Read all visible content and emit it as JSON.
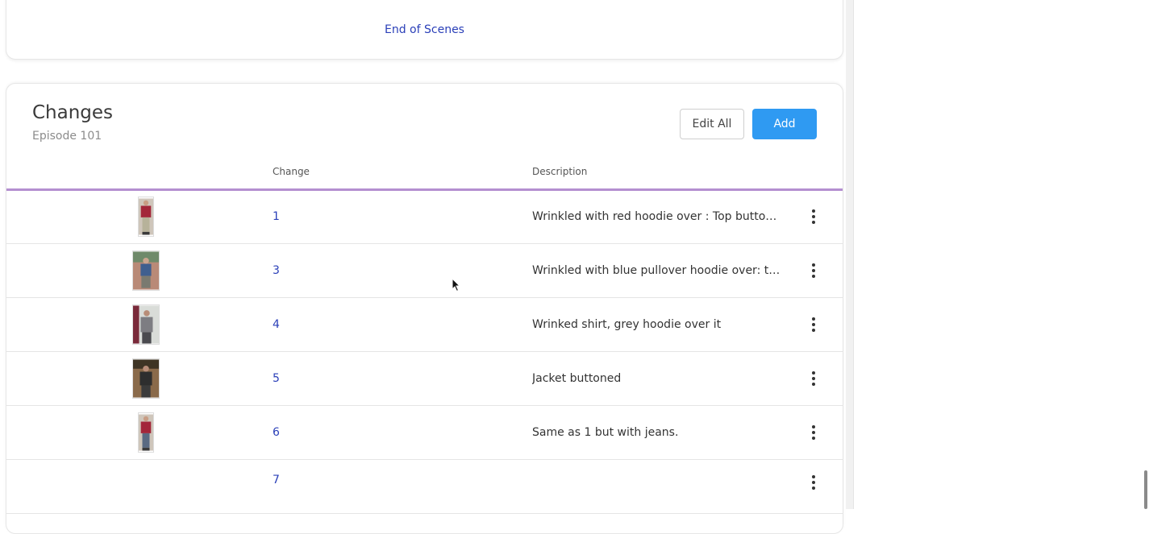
{
  "scenes": {
    "end_label": "End of Scenes"
  },
  "changes": {
    "title": "Changes",
    "subtitle": "Episode 101",
    "edit_all_label": "Edit All",
    "add_label": "Add",
    "columns": {
      "change": "Change",
      "description": "Description"
    },
    "rows": [
      {
        "change": "1",
        "description": "Wrinkled with red hoodie over : Top button u...",
        "thumbnail": "red-hoodie-outfit"
      },
      {
        "change": "3",
        "description": "Wrinkled with blue pullover hoodie over: top...",
        "thumbnail": "blue-hoodie-outfit"
      },
      {
        "change": "4",
        "description": "Wrinked shirt, grey hoodie over it",
        "thumbnail": "grey-hoodie-outfit"
      },
      {
        "change": "5",
        "description": "Jacket buttoned",
        "thumbnail": "jacket-outfit"
      },
      {
        "change": "6",
        "description": "Same as 1 but with jeans.",
        "thumbnail": "red-hoodie-jeans-outfit"
      },
      {
        "change": "7",
        "description": "",
        "thumbnail": ""
      }
    ]
  },
  "colors": {
    "accent": "#2f9af2",
    "link": "#2a3fb8",
    "header_rule": "#b48fd0"
  }
}
